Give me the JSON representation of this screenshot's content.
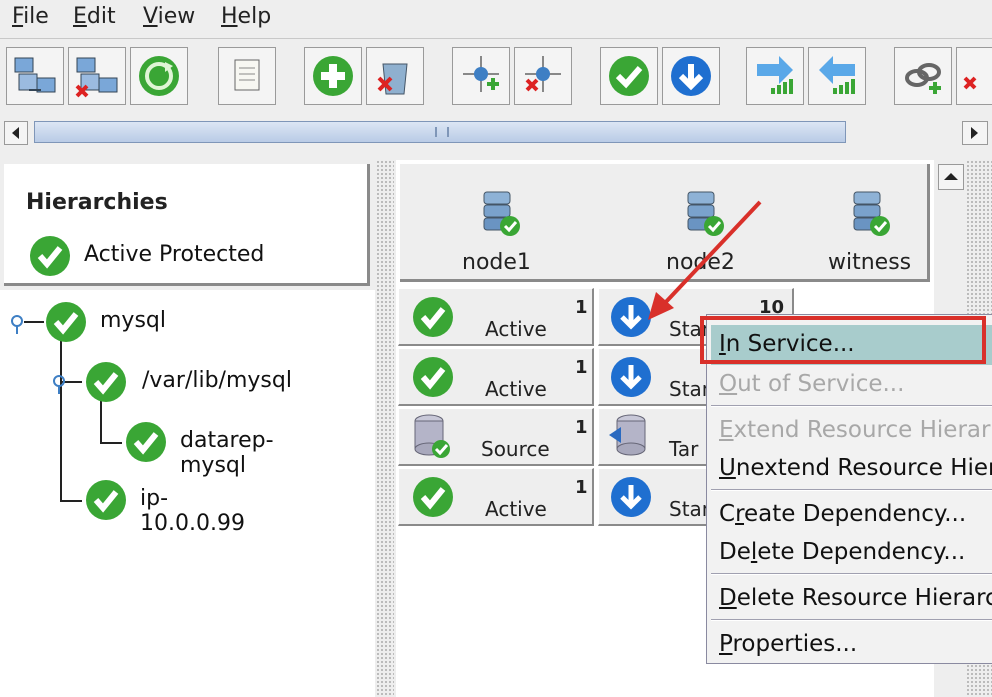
{
  "menubar": {
    "file": {
      "mnemonic": "F",
      "rest": "ile"
    },
    "edit": {
      "mnemonic": "E",
      "rest": "dit"
    },
    "view": {
      "mnemonic": "V",
      "rest": "iew"
    },
    "help": {
      "mnemonic": "H",
      "rest": "elp"
    }
  },
  "toolbar": {
    "icons": [
      "connect-server-icon",
      "disconnect-server-icon",
      "refresh-icon",
      "scroll-log-icon",
      "create-resource-icon",
      "delete-resource-icon",
      "add-comm-path-icon",
      "delete-comm-path-icon",
      "in-service-icon",
      "out-of-service-icon",
      "extend-hierarchy-icon",
      "unextend-hierarchy-icon",
      "create-dependency-icon",
      "delete-dependency-icon"
    ]
  },
  "left_panel": {
    "title": "Hierarchies",
    "status_label": "Active Protected",
    "tree": [
      {
        "label": "mysql",
        "status": "active"
      },
      {
        "label": "/var/lib/mysql",
        "status": "active"
      },
      {
        "label": "datarep-mysql",
        "status": "active"
      },
      {
        "label": "ip-10.0.0.99",
        "status": "active"
      }
    ]
  },
  "right_panel": {
    "nodes": [
      "node1",
      "node2",
      "witness"
    ],
    "rows": [
      {
        "node1": {
          "label": "Active",
          "priority": "1"
        },
        "node2": {
          "label": "Stan",
          "priority": "10"
        }
      },
      {
        "node1": {
          "label": "Active",
          "priority": "1"
        },
        "node2": {
          "label": "Stan",
          "priority": ""
        }
      },
      {
        "node1": {
          "label": "Source",
          "priority": "1"
        },
        "node2": {
          "label": "Tar",
          "priority": ""
        }
      },
      {
        "node1": {
          "label": "Active",
          "priority": "1"
        },
        "node2": {
          "label": "Stan",
          "priority": ""
        }
      }
    ]
  },
  "context_menu": {
    "items": [
      {
        "mn": "I",
        "rest": "n Service...",
        "enabled": true
      },
      {
        "mn": "O",
        "rest": "ut of Service...",
        "enabled": false
      },
      {
        "mn": "E",
        "rest": "xtend Resource Hierar",
        "enabled": false
      },
      {
        "mn": "U",
        "rest": "nextend Resource Hier",
        "enabled": true
      },
      {
        "pre": "C",
        "mn": "r",
        "rest": "eate Dependency...",
        "enabled": true
      },
      {
        "pre": "De",
        "mn": "l",
        "rest": "ete Dependency...",
        "enabled": true
      },
      {
        "mn": "D",
        "rest": "elete Resource Hierarc",
        "enabled": true
      },
      {
        "mn": "P",
        "rest": "roperties...",
        "enabled": true
      }
    ]
  },
  "colors": {
    "highlight": "#a8cccc",
    "annotation_red": "#d9302a",
    "active_green": "#3aa635",
    "standby_blue": "#1f6fd0"
  }
}
